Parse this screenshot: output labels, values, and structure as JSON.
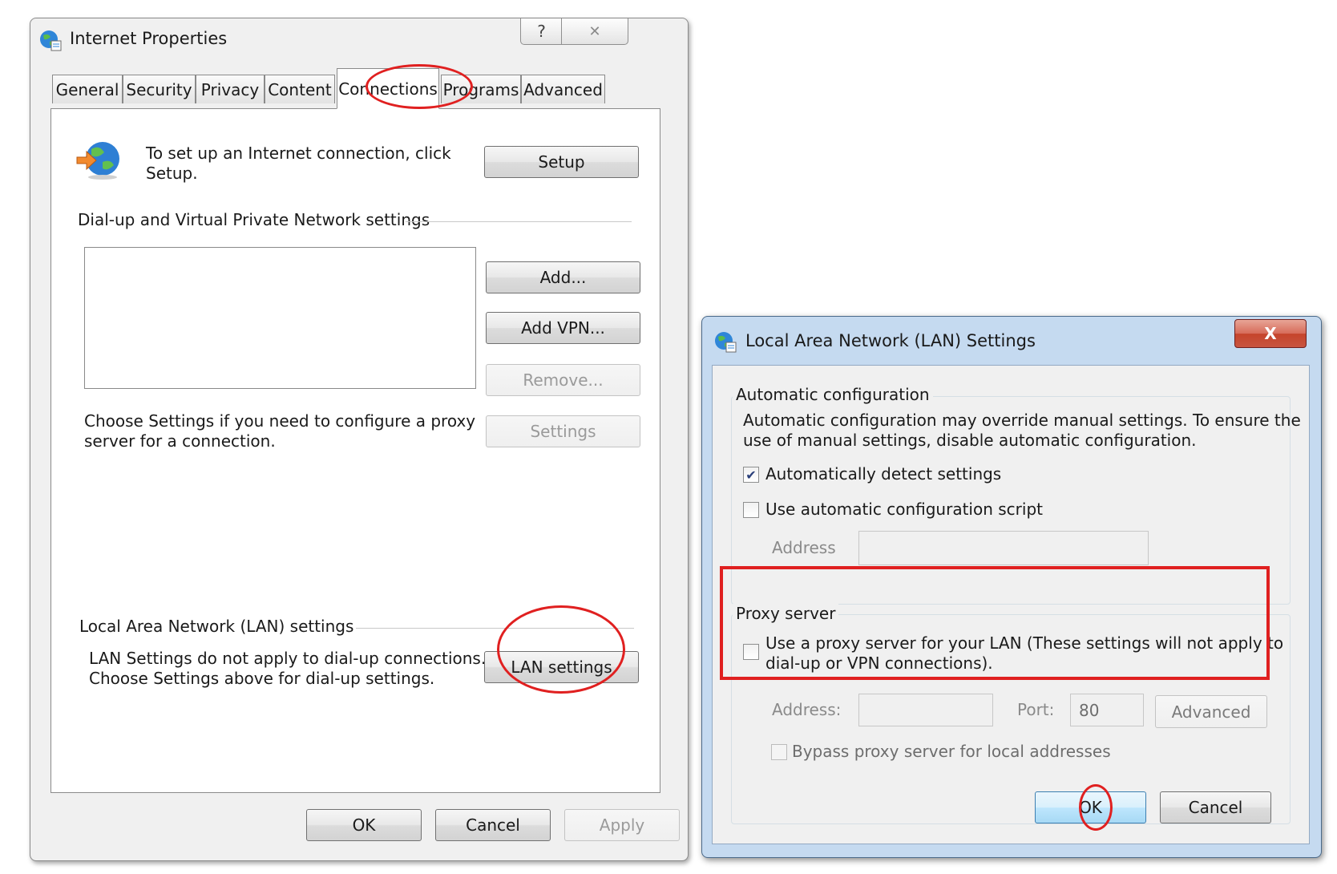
{
  "internet_properties": {
    "title": "Internet Properties",
    "help_button": "?",
    "close_button": "✕",
    "tabs": [
      {
        "label": "General"
      },
      {
        "label": "Security"
      },
      {
        "label": "Privacy"
      },
      {
        "label": "Content"
      },
      {
        "label": "Connections"
      },
      {
        "label": "Programs"
      },
      {
        "label": "Advanced"
      }
    ],
    "active_tab": "Connections",
    "setup_text_line1": "To set up an Internet connection, click",
    "setup_text_line2": "Setup.",
    "setup_button": "Setup",
    "dialup_group_label": "Dial-up and Virtual Private Network settings",
    "add_button": "Add...",
    "add_vpn_button": "Add VPN...",
    "remove_button": "Remove...",
    "settings_button": "Settings",
    "proxy_hint_line1": "Choose Settings if you need to configure a proxy",
    "proxy_hint_line2": "server for a connection.",
    "lan_group_label": "Local Area Network (LAN) settings",
    "lan_text_line1": "LAN Settings do not apply to dial-up connections.",
    "lan_text_line2": "Choose Settings above for dial-up settings.",
    "lan_settings_button": "LAN settings",
    "ok_button": "OK",
    "cancel_button": "Cancel",
    "apply_button": "Apply"
  },
  "lan_settings": {
    "title": "Local Area Network (LAN) Settings",
    "close_button": "X",
    "auto_config_label": "Automatic configuration",
    "auto_config_text_line1": "Automatic configuration may override manual settings.  To ensure the",
    "auto_config_text_line2": "use of manual settings, disable automatic configuration.",
    "auto_detect_label": "Automatically detect settings",
    "auto_detect_checked": true,
    "auto_script_label": "Use automatic configuration script",
    "auto_script_checked": false,
    "script_address_label": "Address",
    "script_address_value": "",
    "proxy_group_label": "Proxy server",
    "use_proxy_line1": "Use a proxy server for your LAN (These settings will not apply to",
    "use_proxy_line2": "dial-up or VPN connections).",
    "use_proxy_checked": false,
    "proxy_address_label": "Address:",
    "proxy_address_value": "",
    "port_label": "Port:",
    "port_value": "80",
    "advanced_button": "Advanced",
    "bypass_label": "Bypass proxy server for local addresses",
    "bypass_checked": false,
    "ok_button": "OK",
    "cancel_button": "Cancel"
  },
  "annotation_color": "#e02020"
}
